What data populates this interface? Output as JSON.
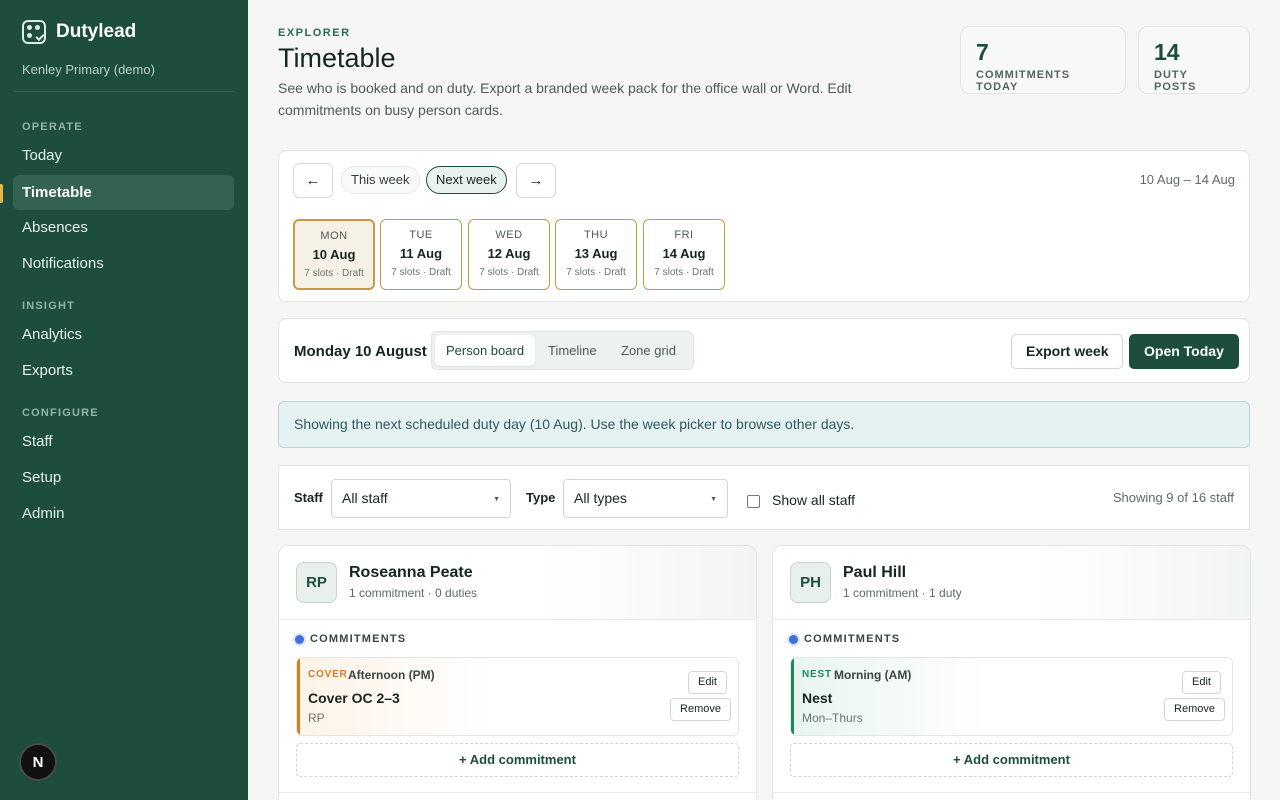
{
  "app": {
    "name": "Dutylead",
    "school": "Kenley Primary (demo)"
  },
  "sidebar": {
    "sections": [
      {
        "label": "OPERATE",
        "items": [
          "Today",
          "Timetable",
          "Absences",
          "Notifications"
        ]
      },
      {
        "label": "INSIGHT",
        "items": [
          "Analytics",
          "Exports"
        ]
      },
      {
        "label": "CONFIGURE",
        "items": [
          "Staff",
          "Setup",
          "Admin"
        ]
      }
    ],
    "active": "Timetable",
    "badge": "N"
  },
  "header": {
    "eyebrow": "EXPLORER",
    "title": "Timetable",
    "subtitle": "See who is booked and on duty. Export a branded week pack for the office wall or Word. Edit commitments on busy person cards."
  },
  "stats": [
    {
      "value": "7",
      "label": "COMMITMENTS TODAY"
    },
    {
      "value": "14",
      "label": "DUTY POSTS"
    }
  ],
  "week": {
    "prev_icon": "←",
    "next_icon": "→",
    "this_week": "This week",
    "next_week": "Next week",
    "selected": "Next week",
    "range": "10 Aug – 14 Aug",
    "days": [
      {
        "dow": "MON",
        "date": "10 Aug",
        "info": "7 slots · Draft"
      },
      {
        "dow": "TUE",
        "date": "11 Aug",
        "info": "7 slots · Draft"
      },
      {
        "dow": "WED",
        "date": "12 Aug",
        "info": "7 slots · Draft"
      },
      {
        "dow": "THU",
        "date": "13 Aug",
        "info": "7 slots · Draft"
      },
      {
        "dow": "FRI",
        "date": "14 Aug",
        "info": "7 slots · Draft"
      }
    ],
    "selected_day": 0
  },
  "toolbar": {
    "date": "Monday 10 August",
    "views": [
      "Person board",
      "Timeline",
      "Zone grid"
    ],
    "active_view": "Person board",
    "export": "Export week",
    "open_today": "Open Today"
  },
  "notice": "Showing the next scheduled duty day (10 Aug). Use the week picker to browse other days.",
  "filters": {
    "staff_label": "Staff",
    "staff_value": "All staff",
    "type_label": "Type",
    "type_value": "All types",
    "show_all": "Show all staff",
    "show_all_checked": false,
    "showing": "Showing 9 of 16 staff"
  },
  "people": [
    {
      "initials": "RP",
      "name": "Roseanna Peate",
      "summary": "1 commitment · 0 duties",
      "section": "COMMITMENTS",
      "commitment": {
        "tag": "COVER",
        "slot": "Afternoon (PM)",
        "title": "Cover OC 2–3",
        "sub": "RP",
        "color": "#d97a1f",
        "tint": "#fdf3e7"
      },
      "edit": "Edit",
      "remove": "Remove",
      "add": "+ Add commitment"
    },
    {
      "initials": "PH",
      "name": "Paul Hill",
      "summary": "1 commitment · 1 duty",
      "section": "COMMITMENTS",
      "commitment": {
        "tag": "NEST",
        "slot": "Morning (AM)",
        "title": "Nest",
        "sub": "Mon–Thurs",
        "color": "#1c8a5c",
        "tint": "#e8f5ee"
      },
      "edit": "Edit",
      "remove": "Remove",
      "add": "+ Add commitment"
    }
  ]
}
